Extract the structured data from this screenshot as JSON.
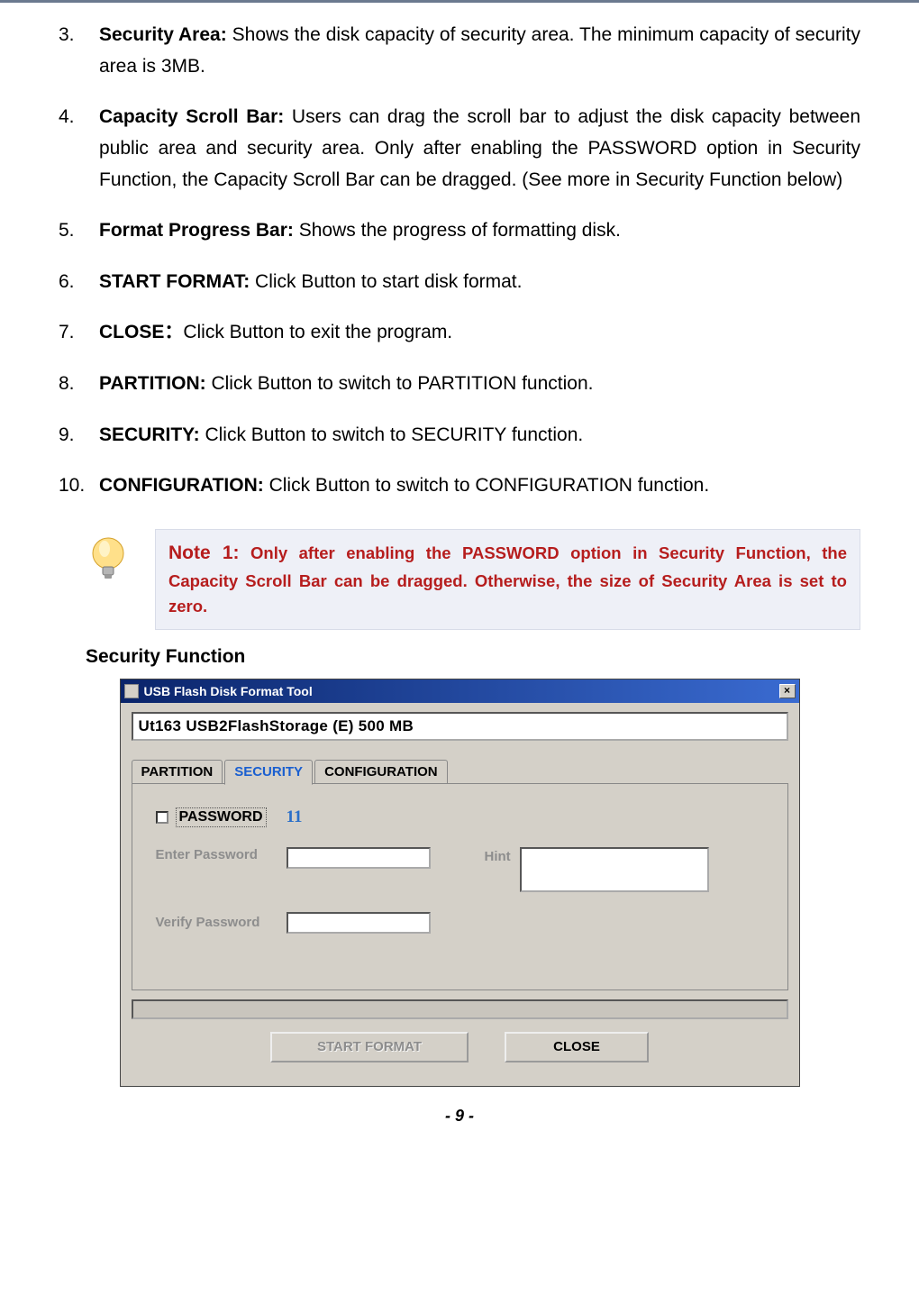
{
  "list": [
    {
      "n": "3.",
      "bold": "Security Area:",
      "rest": " Shows the disk capacity of security area. The minimum capacity of security area is 3MB."
    },
    {
      "n": "4.",
      "bold": "Capacity Scroll Bar:",
      "rest": " Users can drag the scroll bar to adjust the disk capacity between public area and security area. Only after enabling the PASSWORD option in Security Function, the Capacity Scroll Bar can be dragged. (See more in Security Function below)"
    },
    {
      "n": "5.",
      "bold": "Format Progress Bar:",
      "rest": " Shows the progress of formatting disk."
    },
    {
      "n": "6.",
      "bold": "START FORMAT:",
      "rest": " Click Button to start disk format."
    },
    {
      "n": "7.",
      "bold": "CLOSE：",
      "rest": "Click Button to exit the program."
    },
    {
      "n": "8.",
      "bold": "PARTITION:",
      "rest": " Click Button to switch to PARTITION function."
    },
    {
      "n": "9.",
      "bold": "SECURITY:",
      "rest": " Click Button to switch to SECURITY function."
    },
    {
      "n": "10.",
      "bold": "CONFIGURATION:",
      "rest": " Click Button to switch to CONFIGURATION function."
    }
  ],
  "note": {
    "label": "Note 1:",
    "text": " Only after enabling the PASSWORD option in Security Function, the Capacity Scroll Bar can be dragged. Otherwise, the size of Security Area is set to zero."
  },
  "section_heading": "Security Function",
  "dialog": {
    "title": "USB Flash Disk Format Tool",
    "close_x": "×",
    "device": "Ut163    USB2FlashStorage (E)  500 MB",
    "tabs": {
      "partition": "PARTITION",
      "security": "SECURITY",
      "configuration": "CONFIGURATION"
    },
    "password_label": "PASSWORD",
    "annotation": "11",
    "enter_pw": "Enter Password",
    "verify_pw": "Verify Password",
    "hint": "Hint",
    "start_format": "START FORMAT",
    "close": "CLOSE"
  },
  "page_number": "- 9 -"
}
